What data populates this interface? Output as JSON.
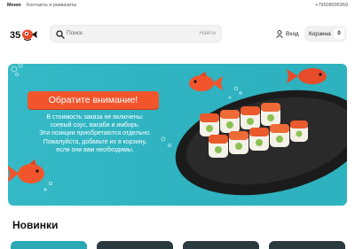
{
  "topbar": {
    "menu": "Меню",
    "contacts": "Контакты и реквизиты",
    "phone": "+79508095959"
  },
  "header": {
    "logo_text": "35",
    "search_placeholder": "Поиск",
    "search_button": "Найти",
    "login_label": "Вход",
    "cart_label": "Корзина",
    "cart_count": "0"
  },
  "banner": {
    "notice": "Обратите внимание!",
    "lines": [
      "В стоимость заказа не включены:",
      "соевый соус, васаби и имбирь.",
      "Эти позиции приобретаются отдельно.",
      "Пожалуйста, добавьте их в корзину,",
      "если они вам необходимы."
    ]
  },
  "sections": {
    "new_title": "Новинки"
  },
  "colors": {
    "accent": "#f2552c",
    "banner_bg": "#35b9c6",
    "card_teal": "#2aa8b6",
    "card_dark": "#2b3a3f"
  },
  "icons": {
    "search": "search-icon",
    "user": "user-icon"
  }
}
